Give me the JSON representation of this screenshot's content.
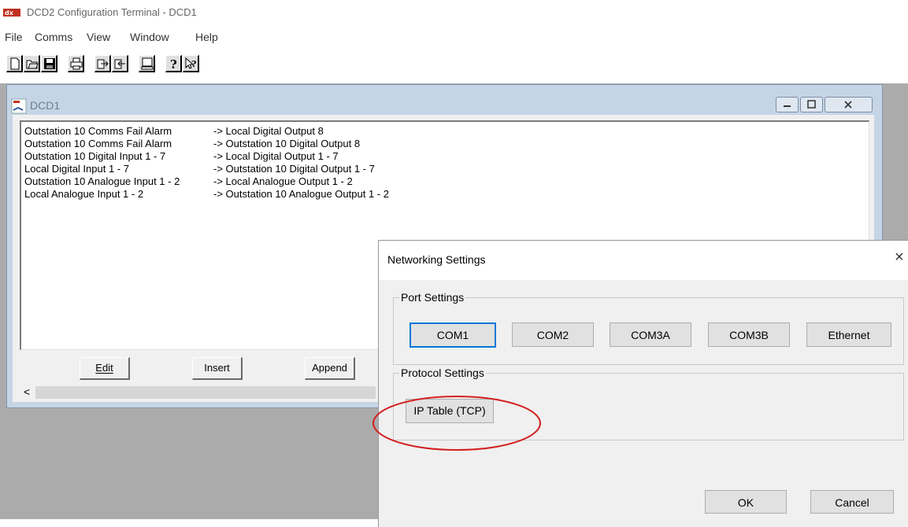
{
  "app": {
    "title": "DCD2 Configuration Terminal - DCD1",
    "icon": "app-logo-icon"
  },
  "menu": [
    "File",
    "Comms",
    "View",
    "Window",
    "Help"
  ],
  "toolbar": {
    "icons": [
      "new-file-icon",
      "open-file-icon",
      "save-icon",
      "print-icon",
      "export-icon",
      "import-icon",
      "terminal-icon",
      "help-icon",
      "context-help-icon"
    ]
  },
  "child_window": {
    "title": "DCD1",
    "rows": [
      {
        "source": "Outstation 10 Comms Fail Alarm",
        "target": "-> Local Digital Output 8"
      },
      {
        "source": "Outstation 10 Comms Fail Alarm",
        "target": "-> Outstation 10 Digital Output 8"
      },
      {
        "source": "Outstation 10 Digital Input 1 - 7",
        "target": "-> Local Digital Output 1 - 7"
      },
      {
        "source": "Local Digital Input 1 - 7",
        "target": "-> Outstation 10 Digital Output 1 - 7"
      },
      {
        "source": "Outstation 10 Analogue Input 1 - 2",
        "target": "-> Local Analogue Output 1 - 2"
      },
      {
        "source": "Local Analogue Input 1 - 2",
        "target": "-> Outstation 10 Analogue Output 1 - 2"
      }
    ],
    "buttons": {
      "edit": "Edit",
      "insert": "Insert",
      "append": "Append"
    },
    "scroll_left": "<"
  },
  "dialog": {
    "title": "Networking Settings",
    "close": "×",
    "port_settings": {
      "label": "Port Settings",
      "buttons": [
        "COM1",
        "COM2",
        "COM3A",
        "COM3B",
        "Ethernet"
      ]
    },
    "protocol_settings": {
      "label": "Protocol Settings",
      "button": "IP Table (TCP)"
    },
    "ok": "OK",
    "cancel": "Cancel"
  },
  "colors": {
    "annotation_circle": "#d42020",
    "focus_blue": "#0078d7"
  }
}
